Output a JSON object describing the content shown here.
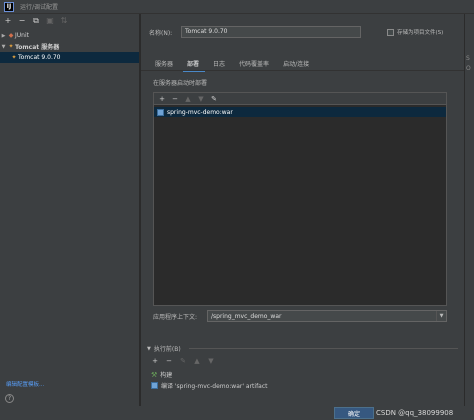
{
  "window": {
    "app_icon": "IJ",
    "title": "运行/调试配置"
  },
  "left_toolbar": {
    "add": "+",
    "remove": "−",
    "copy": "⧉",
    "save": "▣",
    "sort": "⇅"
  },
  "tree": [
    {
      "label": "JUnit",
      "icon": "junit-icon",
      "expanded": false
    },
    {
      "label": "Tomcat 服务器",
      "icon": "tomcat-icon",
      "expanded": true
    },
    {
      "label": "Tomcat 9.0.70",
      "icon": "tomcat-icon",
      "selected": true
    }
  ],
  "edit_templates": "编辑配置模板...",
  "help": "?",
  "form": {
    "name_label": "名称(N):",
    "name_value": "Tomcat 9.0.70",
    "store_label": "存储为项目文件(S)"
  },
  "tabs": [
    {
      "label": "服务器",
      "active": false
    },
    {
      "label": "部署",
      "active": true
    },
    {
      "label": "日志",
      "active": false
    },
    {
      "label": "代码覆盖率",
      "active": false
    },
    {
      "label": "启动/连接",
      "active": false
    }
  ],
  "deploy": {
    "section_label": "在服务器启动时部署",
    "toolbar": {
      "add": "+",
      "remove": "−",
      "up": "▲",
      "down": "▼",
      "edit": "✎"
    },
    "artifacts": [
      "spring-mvc-demo:war"
    ]
  },
  "context": {
    "label": "应用程序上下文:",
    "value": "/spring_mvc_demo_war",
    "arrow": "▼"
  },
  "before_launch": {
    "label": "执行前(B)",
    "caret": "▼",
    "toolbar": {
      "add": "+",
      "remove": "−",
      "edit": "✎",
      "up": "▲",
      "down": "▼"
    },
    "tasks": [
      {
        "label": "构建",
        "icon": "build-icon"
      },
      {
        "label": "编译 'spring-mvc-demo:war' artifact",
        "icon": "artifact-icon"
      }
    ]
  },
  "gutter_text": "S\nO",
  "buttons": {
    "ok": "确定"
  },
  "watermark": "CSDN @qq_38099908",
  "colors": {
    "background": "#3c3f41",
    "selection": "#0d293e",
    "accent": "#4a88c7",
    "ok_button": "#365880",
    "link": "#589df6"
  }
}
